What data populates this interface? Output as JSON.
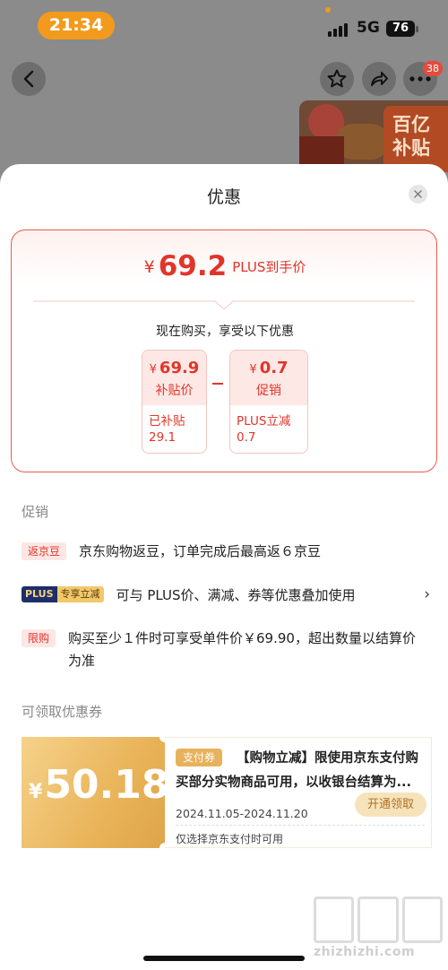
{
  "status_bar": {
    "time": "21:34",
    "network": "5G",
    "battery": "76"
  },
  "header": {
    "notification_count": "38",
    "banner_text": "百亿补贴"
  },
  "sheet": {
    "title": "优惠",
    "price_summary": {
      "currency": "¥",
      "final_price": "69.2",
      "price_label": "PLUS到手价",
      "subtitle": "现在购买，享受以下优惠",
      "items": [
        {
          "currency": "¥",
          "value": "69.9",
          "label": "补贴价",
          "detail_line1": "已补贴",
          "detail_line2": "29.1"
        },
        {
          "currency": "¥",
          "value": "0.7",
          "label": "促销",
          "detail_line1": "PLUS立减",
          "detail_line2": "0.7"
        }
      ]
    },
    "promotions": {
      "section_label": "促销",
      "items": [
        {
          "tag": "返京豆",
          "text": "京东购物返豆，订单完成后最高返６京豆"
        },
        {
          "tag_a": "PLUS",
          "tag_b": "专享立减",
          "text": "可与 PLUS价、满减、券等优惠叠加使用",
          "chevron": "›"
        },
        {
          "tag": "限购",
          "text": "购买至少１件时可享受单件价￥69.90，超出数量以结算价为准"
        }
      ]
    },
    "coupons": {
      "section_label": "可领取优惠券",
      "items": [
        {
          "currency": "¥",
          "amount": "50.18",
          "tag": "支付券",
          "description": "【购物立减】限使用京东支付购买部分实物商品可用，以收银台结算为...",
          "date_range": "2024.11.05-2024.11.20",
          "button_label": "开通领取",
          "note": "仅选择京东支付时可用"
        }
      ]
    }
  },
  "watermark": {
    "text": "zhizhizhi.com"
  },
  "colors": {
    "accent_red": "#e0352a",
    "card_border": "#ea5a4d",
    "coupon_gold": "#e9b45a",
    "plus_navy": "#1d2e6b"
  }
}
